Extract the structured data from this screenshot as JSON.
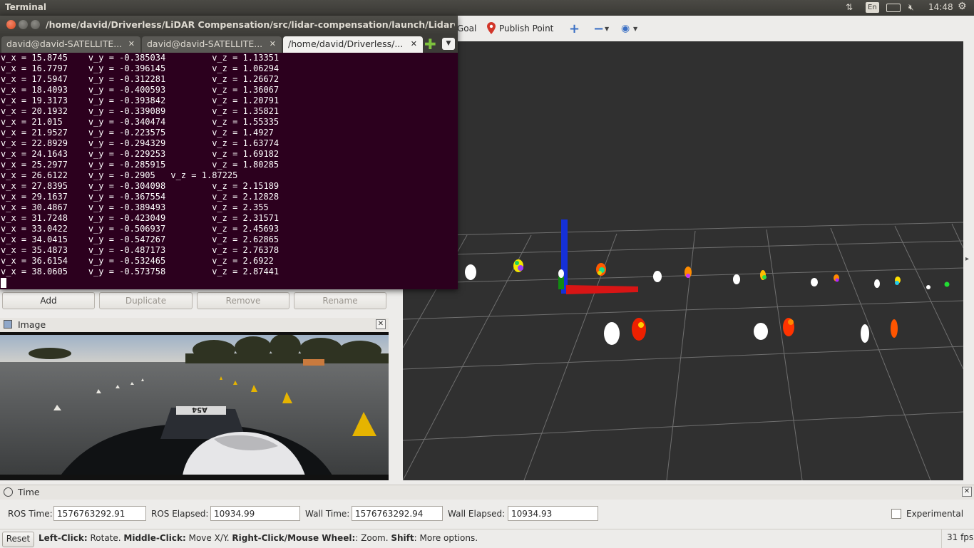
{
  "topbar": {
    "title": "Terminal",
    "keyboard": "En",
    "time": "14:48",
    "icons": [
      "network-arrows-icon",
      "keyboard-icon",
      "battery-icon",
      "volume-mute-icon",
      "gear-icon"
    ]
  },
  "rviz_toolbar": {
    "goal_label": "Goal",
    "publish_point_label": "Publish Point"
  },
  "terminal": {
    "title": "/home/david/Driverless/LiDAR Compensation/src/lidar-compensation/launch/LidarCompensation",
    "tabs": [
      {
        "label": "david@david-SATELLITE..."
      },
      {
        "label": "david@david-SATELLITE..."
      },
      {
        "label": "/home/david/Driverless/..."
      }
    ],
    "lines": [
      "v_x = 15.8745    v_y = -0.385034         v_z = 1.13351",
      "v_x = 16.7797    v_y = -0.396145         v_z = 1.06294",
      "v_x = 17.5947    v_y = -0.312281         v_z = 1.26672",
      "v_x = 18.4093    v_y = -0.400593         v_z = 1.36067",
      "v_x = 19.3173    v_y = -0.393842         v_z = 1.20791",
      "v_x = 20.1932    v_y = -0.339089         v_z = 1.35821",
      "v_x = 21.015     v_y = -0.340474         v_z = 1.55335",
      "v_x = 21.9527    v_y = -0.223575         v_z = 1.4927",
      "v_x = 22.8929    v_y = -0.294329         v_z = 1.63774",
      "v_x = 24.1643    v_y = -0.229253         v_z = 1.69182",
      "v_x = 25.2977    v_y = -0.285915         v_z = 1.80285",
      "v_x = 26.6122    v_y = -0.2905   v_z = 1.87225",
      "v_x = 27.8395    v_y = -0.304098         v_z = 2.15189",
      "v_x = 29.1637    v_y = -0.367554         v_z = 2.12828",
      "v_x = 30.4867    v_y = -0.389493         v_z = 2.355",
      "v_x = 31.7248    v_y = -0.423049         v_z = 2.31571",
      "v_x = 33.0422    v_y = -0.506937         v_z = 2.45693",
      "v_x = 34.0415    v_y = -0.547267         v_z = 2.62865",
      "v_x = 35.4873    v_y = -0.487173         v_z = 2.76378",
      "v_x = 36.6154    v_y = -0.532465         v_z = 2.6922",
      "v_x = 38.0605    v_y = -0.573758         v_z = 2.87441"
    ]
  },
  "displays_panel": {
    "add": "Add",
    "duplicate": "Duplicate",
    "remove": "Remove",
    "rename": "Rename"
  },
  "image_panel": {
    "title": "Image",
    "car_number": "A54"
  },
  "time_panel": {
    "title": "Time",
    "ros_time_label": "ROS Time:",
    "ros_time": "1576763292.91",
    "ros_elapsed_label": "ROS Elapsed:",
    "ros_elapsed": "10934.99",
    "wall_time_label": "Wall Time:",
    "wall_time": "1576763292.94",
    "wall_elapsed_label": "Wall Elapsed:",
    "wall_elapsed": "10934.93",
    "experimental_label": "Experimental"
  },
  "statusbar": {
    "reset": "Reset",
    "hint_left_key": "Left-Click:",
    "hint_left": " Rotate. ",
    "hint_middle_key": "Middle-Click:",
    "hint_middle": " Move X/Y. ",
    "hint_right_key": "Right-Click/Mouse Wheel:",
    "hint_right": ": Zoom. ",
    "hint_shift_key": "Shift",
    "hint_shift": ": More options.",
    "fps": "31 fps"
  },
  "colors": {
    "terminal_bg": "#2c001e",
    "view_bg": "#303030",
    "axis_x": "#e01010",
    "axis_y": "#10a010",
    "axis_z": "#1010e0"
  }
}
